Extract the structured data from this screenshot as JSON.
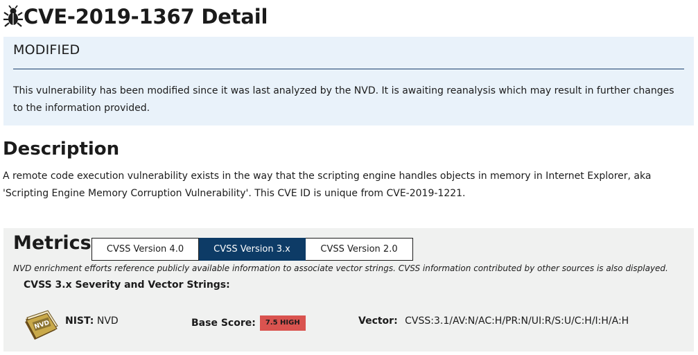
{
  "header": {
    "title": "CVE-2019-1367 Detail",
    "icon": "bug-icon"
  },
  "modified": {
    "heading": "MODIFIED",
    "text": "This vulnerability has been modified since it was last analyzed by the NVD. It is awaiting reanalysis which may result in further changes to the information provided."
  },
  "description": {
    "heading": "Description",
    "text": "A remote code execution vulnerability exists in the way that the scripting engine handles objects in memory in Internet Explorer, aka 'Scripting Engine Memory Corruption Vulnerability'. This CVE ID is unique from CVE-2019-1221."
  },
  "metrics": {
    "heading": "Metrics",
    "tabs": [
      {
        "label": "CVSS Version 4.0",
        "active": false
      },
      {
        "label": "CVSS Version 3.x",
        "active": true
      },
      {
        "label": "CVSS Version 2.0",
        "active": false
      }
    ],
    "note": "NVD enrichment efforts reference publicly available information to associate vector strings. CVSS information contributed by other sources is also displayed.",
    "severity_heading": "CVSS 3.x Severity and Vector Strings:",
    "nist_label": "NIST:",
    "nist_value": "NVD",
    "base_score_label": "Base Score:",
    "base_score_value": "7.5 HIGH",
    "base_score_color": "#d9534f",
    "vector_label": "Vector:",
    "vector_value": "CVSS:3.1/AV:N/AC:H/PR:N/UI:R/S:U/C:H/I:H/A:H",
    "logo_text": "NVD"
  },
  "colors": {
    "modified_bg": "#e9f2fa",
    "metrics_bg": "#f0f1f0",
    "active_tab": "#0d3b66",
    "rule": "#1a3e6b"
  }
}
